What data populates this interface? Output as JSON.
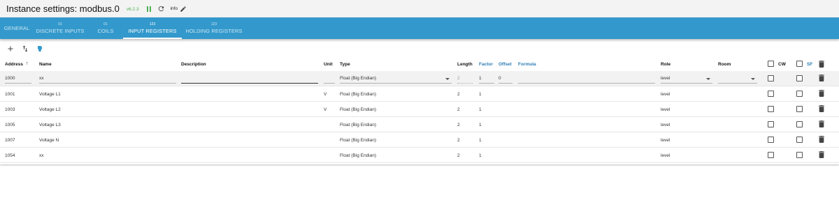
{
  "header": {
    "title": "Instance settings: modbus.0",
    "version": "v6.2.3",
    "info_label": "info"
  },
  "tabs": [
    {
      "count": "",
      "label": "GENERAL",
      "active": false
    },
    {
      "count": "01",
      "label": "DISCRETE INPUTS",
      "active": false
    },
    {
      "count": "01",
      "label": "COILS",
      "active": false
    },
    {
      "count": "123",
      "label": "INPUT REGISTERS",
      "active": true
    },
    {
      "count": "123",
      "label": "HOLDING REGISTERS",
      "active": false
    }
  ],
  "toolbar": {
    "add_icon": "plus-icon",
    "sort_icon": "swap-vertical-icon",
    "export_icon": "import-export-icon"
  },
  "table": {
    "columns": {
      "address": "Address",
      "sort_indicator": "↑",
      "name": "Name",
      "description": "Description",
      "unit": "Unit",
      "type": "Type",
      "length": "Length",
      "factor": "Factor",
      "offset": "Offset",
      "formula": "Formula",
      "role": "Role",
      "room": "Room",
      "cw": "CW",
      "sf": "SF"
    },
    "edit_row": {
      "address": "1000",
      "name": "xx",
      "description": "",
      "unit": "",
      "type": "Float (Big Endian)",
      "length": "2",
      "factor": "1",
      "offset": "0",
      "formula": "",
      "role": "level",
      "room": ""
    },
    "rows": [
      {
        "address": "1001",
        "name": "Voltage L1",
        "unit": "V",
        "type": "Float (Big Endian)",
        "length": "2",
        "factor": "1",
        "role": "level"
      },
      {
        "address": "1003",
        "name": "Voltage L2",
        "unit": "V",
        "type": "Float (Big Endian)",
        "length": "2",
        "factor": "1",
        "role": "level"
      },
      {
        "address": "1005",
        "name": "Voltage L3",
        "unit": "",
        "type": "Float (Big Endian)",
        "length": "2",
        "factor": "1",
        "role": "level"
      },
      {
        "address": "1007",
        "name": "Voltage N",
        "unit": "",
        "type": "Float (Big Endian)",
        "length": "2",
        "factor": "1",
        "role": "level"
      },
      {
        "address": "1054",
        "name": "xx",
        "unit": "",
        "type": "Float (Big Endian)",
        "length": "2",
        "factor": "1",
        "role": "level"
      }
    ]
  },
  "colors": {
    "tab_bar": "#3399cc",
    "version_green": "#4caf50",
    "header_blue": "#2c7db5"
  }
}
